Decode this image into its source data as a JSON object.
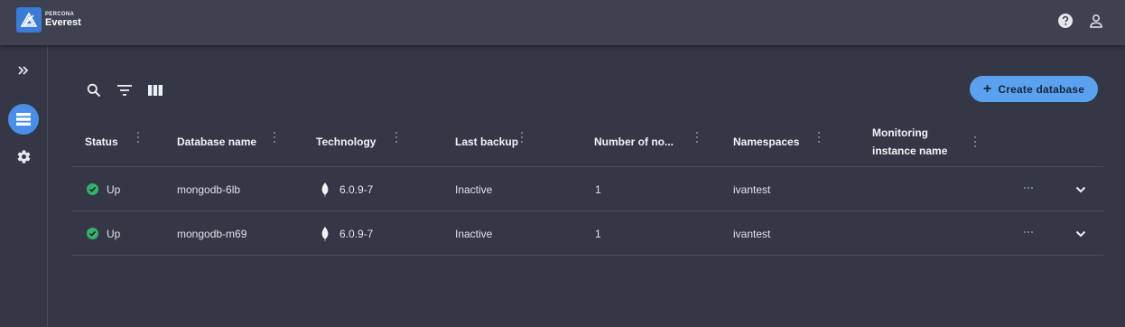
{
  "brand": {
    "small": "PERCONA",
    "name": "Everest"
  },
  "colors": {
    "accent": "#5aa2f0",
    "status_up": "#35b26a",
    "background": "#343846",
    "topbar": "#3e4250"
  },
  "topbar_icons": [
    "help-icon",
    "user-icon"
  ],
  "sidenav_icons": [
    "expand-icon",
    "databases-icon",
    "settings-icon"
  ],
  "toolbar_icons": [
    "search-icon",
    "filter-icon",
    "columns-icon"
  ],
  "create_button": {
    "label": "Create database",
    "icon": "plus-icon"
  },
  "table": {
    "columns": [
      {
        "label": "Status"
      },
      {
        "label": "Database name"
      },
      {
        "label": "Technology"
      },
      {
        "label": "Last backup"
      },
      {
        "label": "Number of no..."
      },
      {
        "label": "Namespaces"
      },
      {
        "label": "Monitoring instance name"
      }
    ],
    "rows": [
      {
        "status": "Up",
        "name": "mongodb-6lb",
        "technology": "6.0.9-7",
        "tech_icon": "mongodb-leaf-icon",
        "last_backup": "Inactive",
        "nodes": "1",
        "namespace": "ivantest",
        "monitoring": ""
      },
      {
        "status": "Up",
        "name": "mongodb-m69",
        "technology": "6.0.9-7",
        "tech_icon": "mongodb-leaf-icon",
        "last_backup": "Inactive",
        "nodes": "1",
        "namespace": "ivantest",
        "monitoring": ""
      }
    ]
  }
}
